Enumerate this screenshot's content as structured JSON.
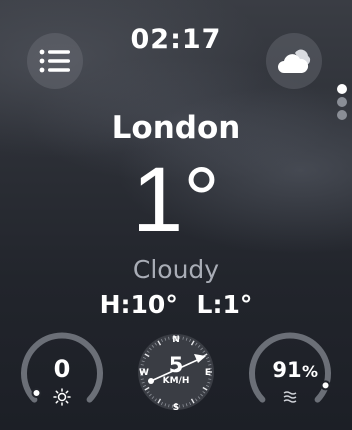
{
  "status": {
    "time": "02:17"
  },
  "header": {
    "menu_icon": "list-icon",
    "weather_icon": "cloud-icon"
  },
  "page_indicator": {
    "count": 3,
    "active": 0
  },
  "location": {
    "city": "London"
  },
  "current": {
    "temperature": "1°",
    "condition": "Cloudy",
    "high": "H:10°",
    "low": "L:1°"
  },
  "complications": {
    "uv": {
      "value": "0",
      "icon": "sun-icon"
    },
    "wind": {
      "speed": "5",
      "unit": "KM/H",
      "north": "N",
      "south": "S",
      "east": "E",
      "west": "W"
    },
    "humidity": {
      "value": "91",
      "unit": "%",
      "level": 0.91,
      "icon": "humidity-icon"
    }
  },
  "colors": {
    "accent_gray": "#6b6f77",
    "text": "#ffffff",
    "muted": "#a9adb6"
  }
}
